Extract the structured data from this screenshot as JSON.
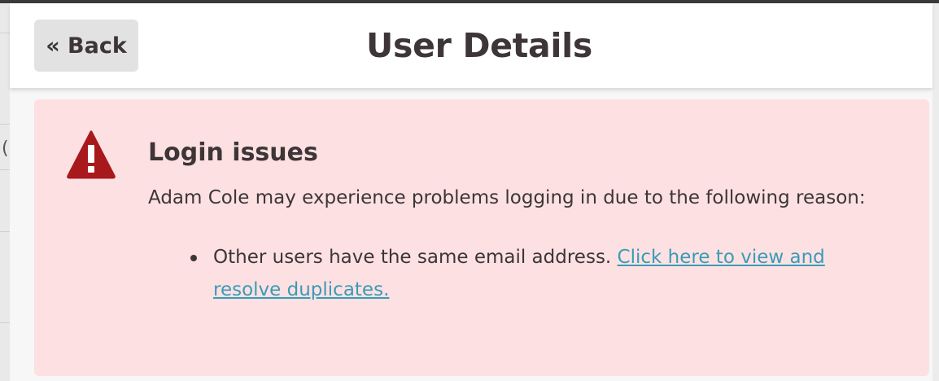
{
  "header": {
    "back_label": "« Back",
    "title": "User Details"
  },
  "alert": {
    "icon": "warning-triangle-icon",
    "title": "Login issues",
    "message": "Adam Cole may experience problems logging in due to the following reason:",
    "issues": [
      {
        "text": "Other users have the same email address. ",
        "link_text": "Click here to view and resolve duplicates."
      }
    ]
  },
  "colors": {
    "alert_background": "#fde1e2",
    "warning_icon": "#a8191c",
    "link": "#3a9bb6",
    "text": "#3d3537",
    "back_button_bg": "#e2e2e2"
  }
}
